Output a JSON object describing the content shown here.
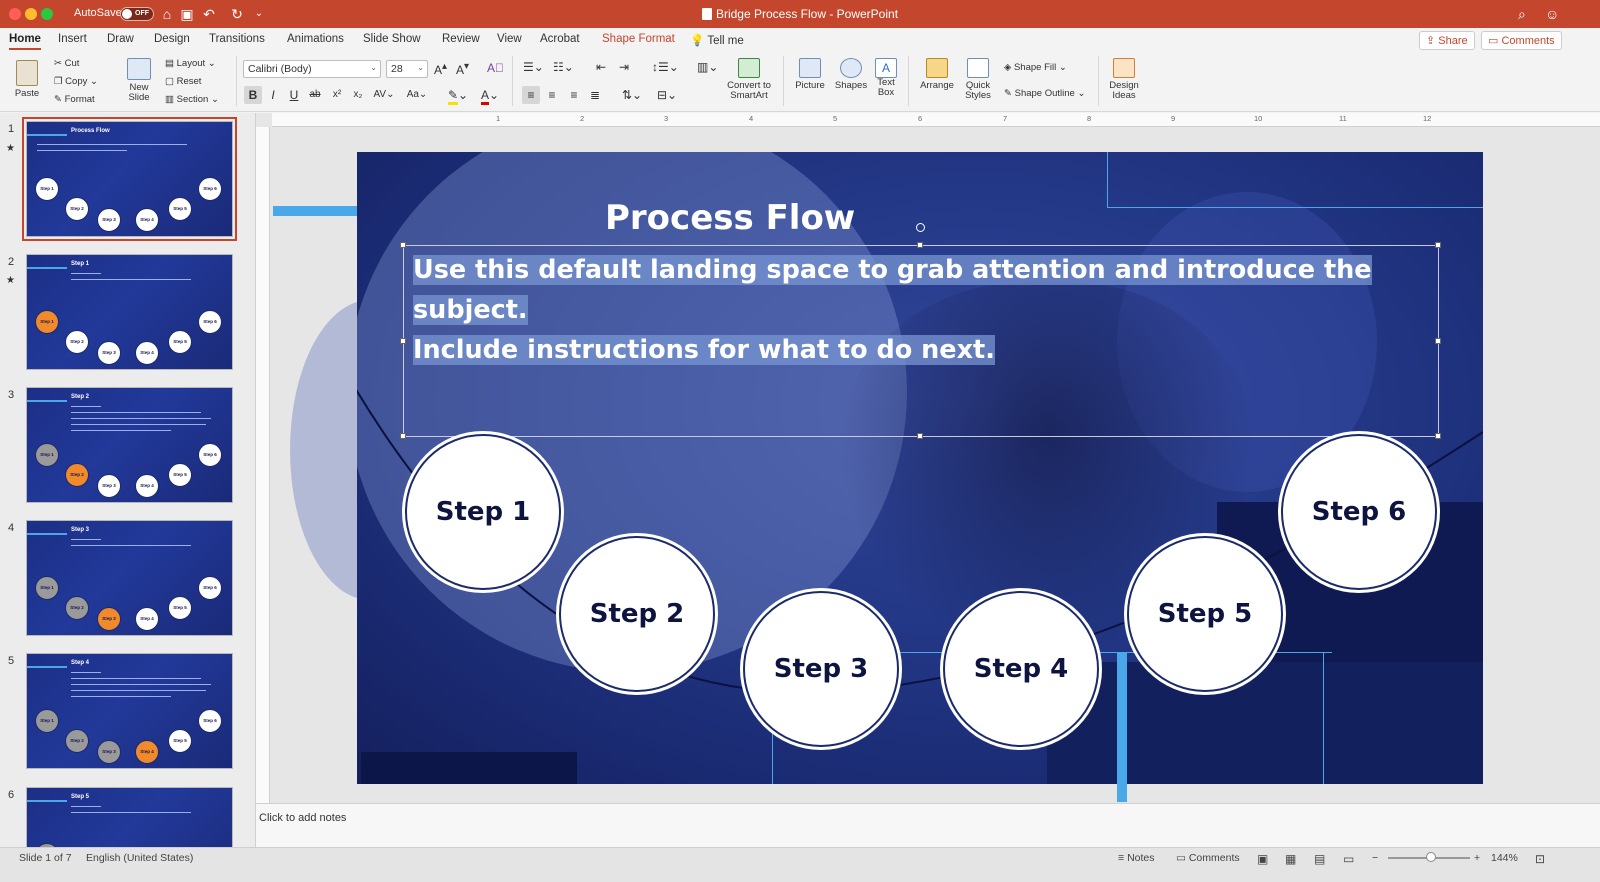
{
  "window": {
    "autosave_label": "AutoSave",
    "autosave_state": "OFF",
    "doc_title": "Bridge Process Flow - PowerPoint"
  },
  "tabs": [
    "Home",
    "Insert",
    "Draw",
    "Design",
    "Transitions",
    "Animations",
    "Slide Show",
    "Review",
    "View",
    "Acrobat",
    "Shape Format"
  ],
  "tell_me": "Tell me",
  "share_label": "Share",
  "comments_label": "Comments",
  "ribbon": {
    "paste": "Paste",
    "cut": "Cut",
    "copy": "Copy",
    "format": "Format",
    "new_slide_1": "New",
    "new_slide_2": "Slide",
    "layout": "Layout",
    "reset": "Reset",
    "section": "Section",
    "font_name": "Calibri (Body)",
    "font_size": "28",
    "convert_1": "Convert to",
    "convert_2": "SmartArt",
    "picture": "Picture",
    "shapes": "Shapes",
    "textbox_1": "Text",
    "textbox_2": "Box",
    "arrange": "Arrange",
    "quick_1": "Quick",
    "quick_2": "Styles",
    "shape_fill": "Shape Fill",
    "shape_outline": "Shape Outline",
    "design_1": "Design",
    "design_2": "Ideas"
  },
  "thumbnails": {
    "numbers": [
      "1",
      "2",
      "3",
      "4",
      "5",
      "6"
    ],
    "titles": [
      "Process Flow",
      "Step 1",
      "Step 2",
      "Step 3",
      "Step 4",
      "Step 5"
    ],
    "step_labels": [
      "Step 1",
      "Step 2",
      "Step 3",
      "Step 4",
      "Step 5",
      "Step 6"
    ]
  },
  "ruler": [
    "1",
    "2",
    "3",
    "4",
    "5",
    "6",
    "7",
    "8",
    "9",
    "10",
    "11",
    "12"
  ],
  "slide": {
    "title": "Process Flow",
    "body_line1": "Use this default landing space to grab attention and introduce the subject.",
    "body_line2": "Include instructions for what to do next.",
    "steps": [
      "Step 1",
      "Step 2",
      "Step 3",
      "Step 4",
      "Step 5",
      "Step 6"
    ]
  },
  "notes_placeholder": "Click to add notes",
  "status": {
    "slide_count": "Slide 1 of 7",
    "language": "English (United States)",
    "notes": "Notes",
    "comments": "Comments",
    "zoom": "144%"
  },
  "colors": {
    "accent": "#c4462d",
    "slide_blue": "#233887",
    "highlight_orange": "#f08a2c",
    "line_cyan": "#4aa8e8"
  }
}
